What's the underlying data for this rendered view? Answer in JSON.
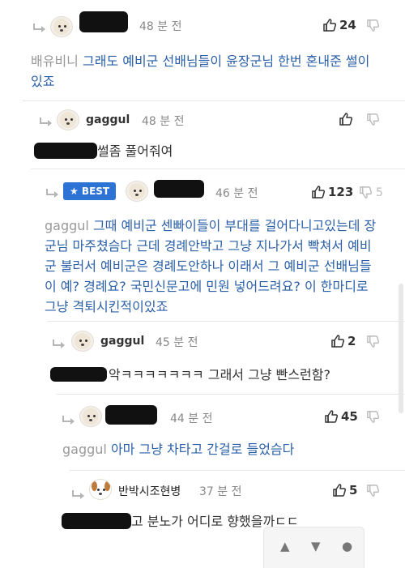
{
  "comments": [
    {
      "nick": "",
      "time": "48 분 전",
      "likes": "24",
      "dislikes": "",
      "mention": "배유비니",
      "text": "그래도 예비군 선배님들이 윤장군님 한번 혼내준 썰이있죠"
    },
    {
      "nick": "gaggul",
      "time": "48 분 전",
      "likes": "",
      "dislikes": "",
      "mention": "",
      "text": "썰좀 풀어줘여"
    },
    {
      "badge": "★ BEST",
      "nick": "",
      "time": "46 분 전",
      "likes": "123",
      "dislikes": "5",
      "mention": "gaggul",
      "text": "그때 예비군 센빠이들이 부대를 걸어다니고있는데 장군님 마주쳤슴다 근데 경례안박고 그냥 지나가서 빡쳐서 예비군 불러서 예비군은 경례도안하나 이래서 그 예비군 선배님들이 예? 경례요? 국민신문고에 민원 넣어드려요? 이 한마디로 그냥 격퇴시킨적이있죠"
    },
    {
      "nick": "gaggul",
      "time": "45 분 전",
      "likes": "2",
      "dislikes": "",
      "mention": "",
      "text": "악ㅋㅋㅋㅋㅋㅋㅋ 그래서 그냥 빤스런함?"
    },
    {
      "nick": "",
      "time": "44 분 전",
      "likes": "45",
      "dislikes": "",
      "mention": "gaggul",
      "text": "아마 그냥 차타고 간걸로 들었슴다"
    },
    {
      "nick": "반박시조현병",
      "time": "37 분 전",
      "likes": "5",
      "dislikes": "",
      "mention": "",
      "text": "고 분노가 어디로 향했을까ㄷㄷ"
    }
  ],
  "icons": {
    "reply": "reply-arrow-icon",
    "like": "thumbs-up-icon",
    "dislike": "thumbs-down-icon",
    "avatar": "dog-avatar-icon"
  },
  "floating_bar": {
    "up": "▲",
    "down": "▼",
    "more": "●"
  },
  "colors": {
    "accent": "#2d73d6",
    "link_text": "#2a5fa8",
    "mention": "#999999"
  }
}
